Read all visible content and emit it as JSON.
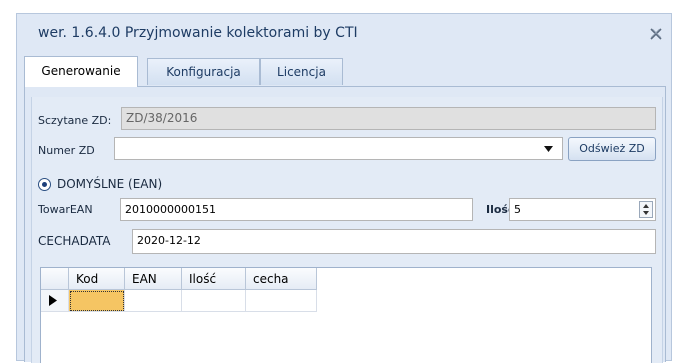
{
  "window": {
    "title": "wer. 1.6.4.0 Przyjmowanie kolektorami by CTI"
  },
  "tabs": [
    {
      "label": "Generowanie",
      "active": true
    },
    {
      "label": "Konfiguracja",
      "active": false
    },
    {
      "label": "Licencja",
      "active": false
    }
  ],
  "form": {
    "scanned_label": "Sczytane ZD:",
    "scanned_value": "ZD/38/2016",
    "numer_label": "Numer ZD",
    "numer_value": "",
    "refresh_label": "Odśwież ZD",
    "mode_label": "DOMYŚLNE (EAN)",
    "towar_label": "TowarEAN",
    "towar_value": "2010000000151",
    "ilosc_label": "Ilość",
    "ilosc_value": "5",
    "cecha_label": "CECHADATA",
    "cecha_value": "2020-12-12"
  },
  "grid": {
    "columns": [
      "Kod",
      "EAN",
      "Ilość",
      "cecha"
    ]
  },
  "colors": {
    "accent": "#1e3c64",
    "selected_cell": "#f5c563",
    "panel": "#dfe8f5"
  }
}
